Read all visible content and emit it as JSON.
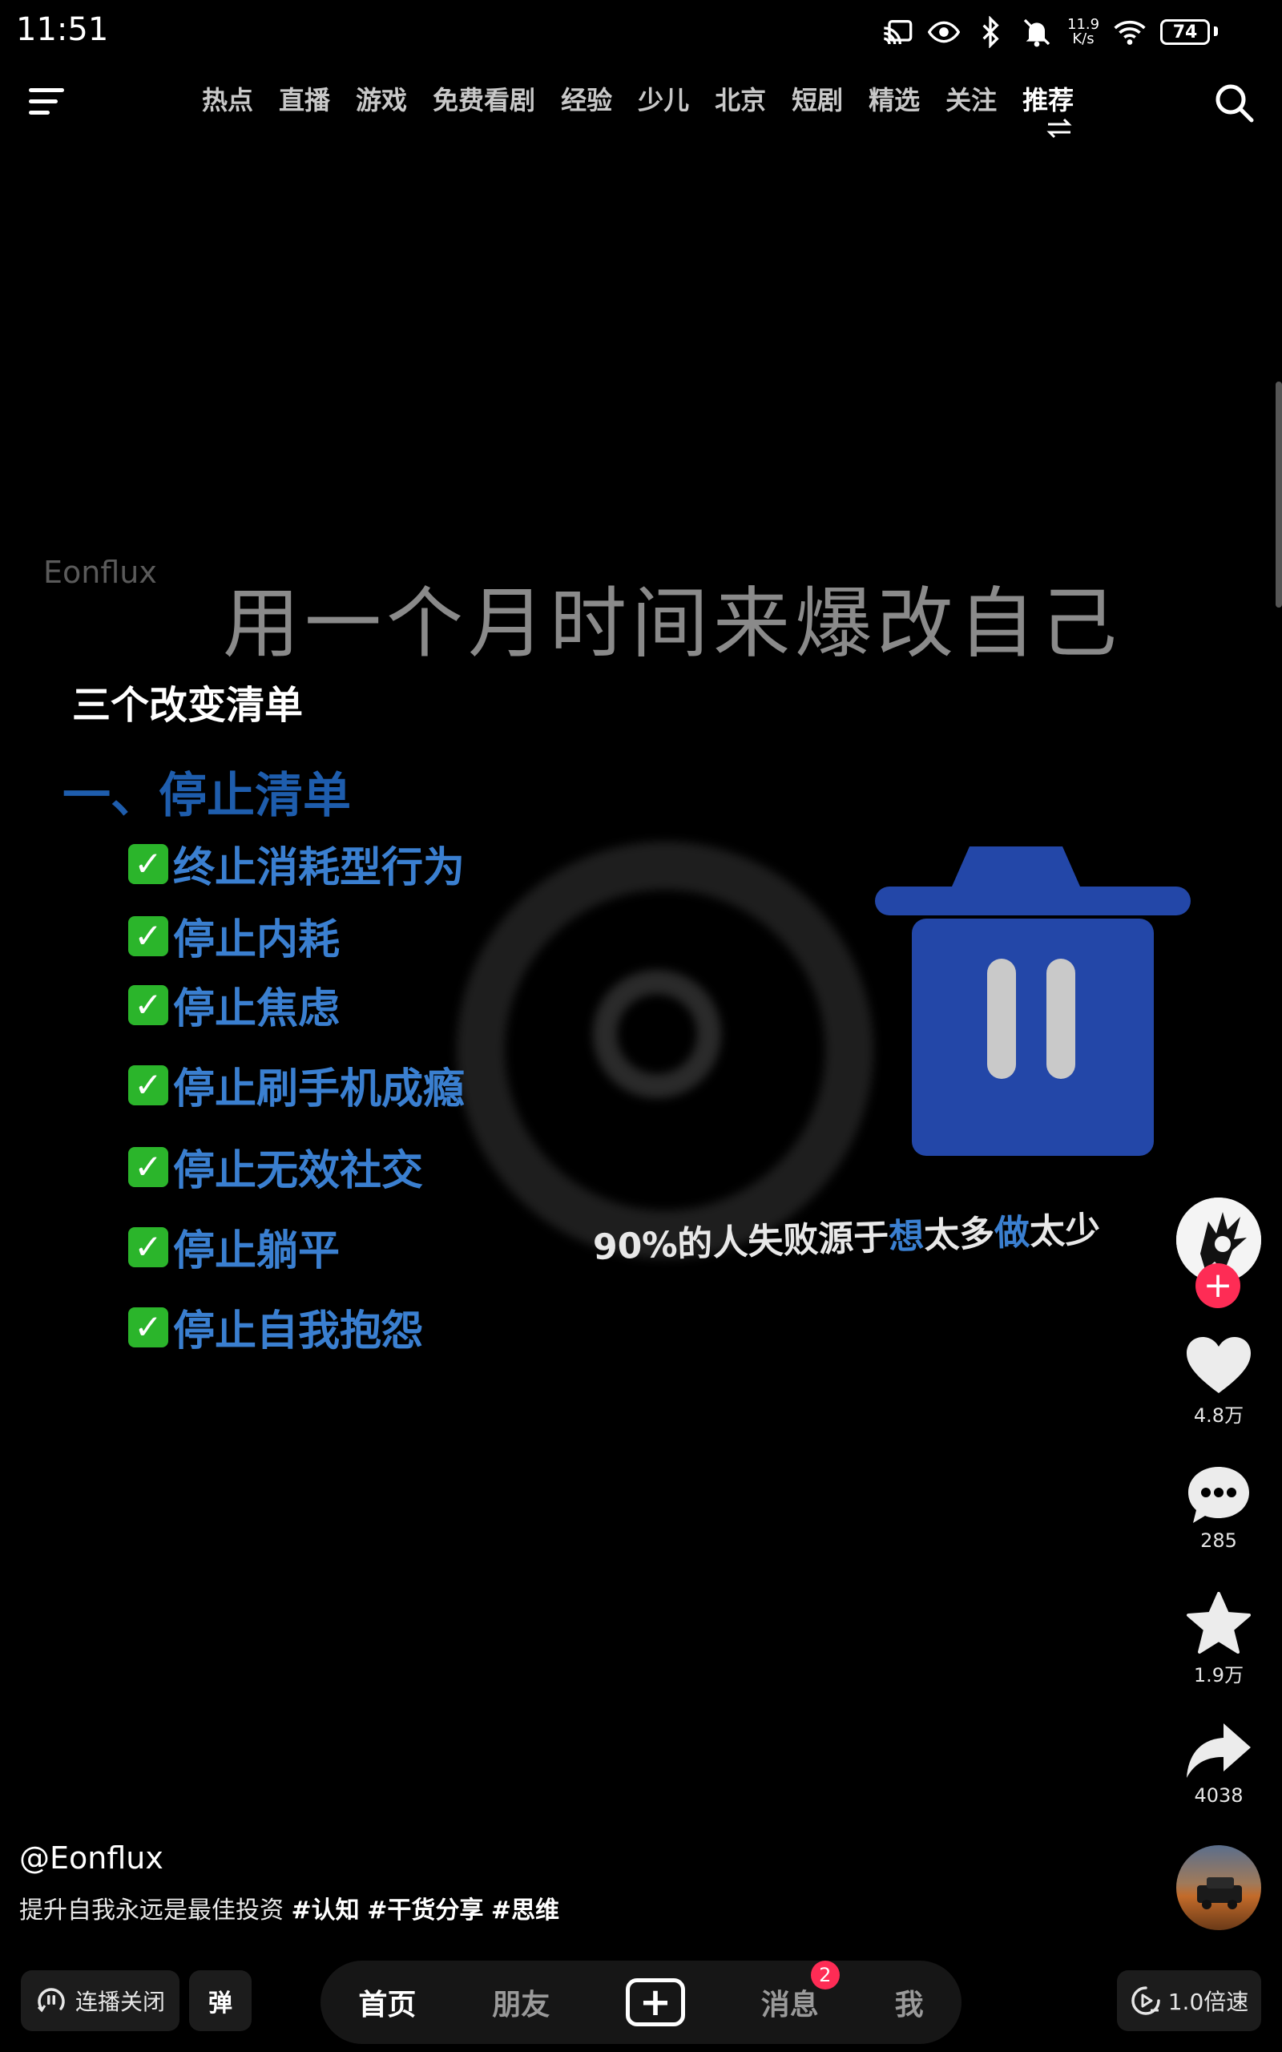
{
  "status_bar": {
    "time": "11:51",
    "net_speed_value": "11.9",
    "net_speed_unit": "K/s",
    "battery": "74"
  },
  "nav": {
    "tabs": [
      {
        "label": "热点"
      },
      {
        "label": "直播"
      },
      {
        "label": "游戏"
      },
      {
        "label": "免费看剧"
      },
      {
        "label": "经验"
      },
      {
        "label": "少儿"
      },
      {
        "label": "北京"
      },
      {
        "label": "短剧"
      },
      {
        "label": "精选"
      },
      {
        "label": "关注"
      },
      {
        "label": "推荐",
        "active": true
      }
    ]
  },
  "video": {
    "watermark": "Eonflux",
    "title": "用一个月时间来爆改自己",
    "list_heading": "三个改变清单",
    "section_title": "一、停止清单",
    "check_items": [
      "终止消耗型行为",
      "停止内耗",
      "停止焦虑",
      "停止刷手机成瘾",
      "停止无效社交",
      "停止躺平",
      "停止自我抱怨"
    ],
    "caption_parts": [
      "90%的人失败源于",
      "想",
      "太多",
      "做",
      "太少"
    ]
  },
  "actions": {
    "likes": "4.8万",
    "comments": "285",
    "favorites": "1.9万",
    "shares": "4038",
    "follow_label": "+"
  },
  "post": {
    "username": "@Eonflux",
    "description": "提升自我永远是最佳投资",
    "hashtags": [
      "#认知",
      "#干货分享",
      "#思维"
    ]
  },
  "bottom_bar": {
    "autoplay_label": "连播关闭",
    "danmaku_label": "弹",
    "tabs": [
      "首页",
      "朋友",
      "消息",
      "我"
    ],
    "create_label": "+",
    "message_badge": "2",
    "speed_label": "1.0倍速"
  },
  "colors": {
    "accent_red": "#fe2c55",
    "list_blue": "#3a7fd0",
    "trash_blue": "#2347a8",
    "check_green": "#2bb52b"
  }
}
